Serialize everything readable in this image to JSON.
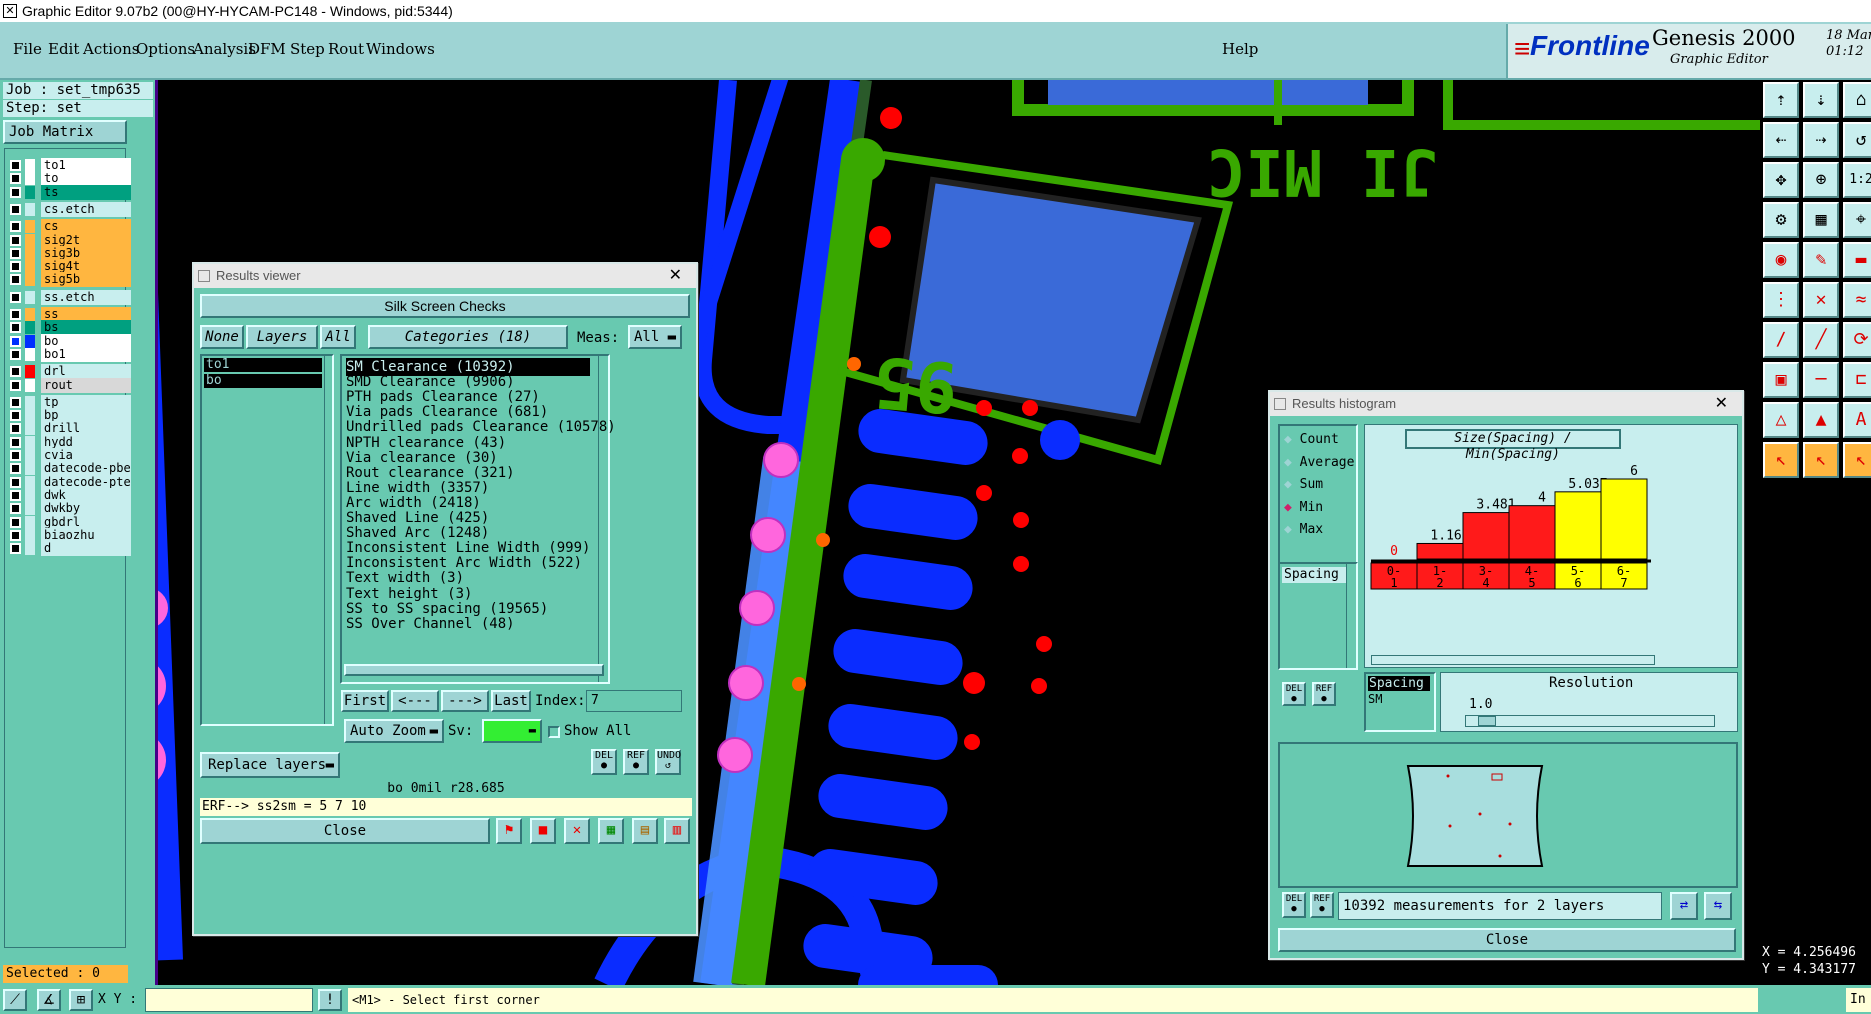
{
  "window": {
    "title": "Graphic Editor 9.07b2 (00@HY-HYCAM-PC148 - Windows, pid:5344)"
  },
  "menu": {
    "items": [
      "File",
      "Edit",
      "Actions",
      "Options",
      "Analysis",
      "DFM",
      "Step",
      "Rout",
      "Windows"
    ],
    "help": "Help"
  },
  "brand": {
    "logo": "Frontline",
    "product": "Genesis 2000",
    "subtitle": "Graphic Editor",
    "date": "18 Mar",
    "time": "01:12"
  },
  "left": {
    "job": "Job : set_tmp635",
    "step": "Step: set",
    "job_matrix": "Job Matrix ...",
    "layers": [
      {
        "name": "to1",
        "color": "#ffffff",
        "bg": "#ffffff",
        "checked": false
      },
      {
        "name": "to",
        "color": "#ffffff",
        "bg": "#ffffff",
        "checked": false
      },
      {
        "name": "ts",
        "color": "#009f80",
        "bg": "#00a080",
        "checked": false
      },
      {
        "name": "cs.etch",
        "color": "#c8eeee",
        "bg": "#c8eeee",
        "checked": false
      },
      {
        "name": "cs",
        "color": "#ffb640",
        "bg": "#ffb640",
        "checked": false
      },
      {
        "name": "sig2t",
        "color": "#ffb640",
        "bg": "#ffb640",
        "checked": false
      },
      {
        "name": "sig3b",
        "color": "#ffb640",
        "bg": "#ffb640",
        "checked": false
      },
      {
        "name": "sig4t",
        "color": "#ffb640",
        "bg": "#ffb640",
        "checked": false
      },
      {
        "name": "sig5b",
        "color": "#ffb640",
        "bg": "#ffb640",
        "checked": false
      },
      {
        "name": "ss.etch",
        "color": "#c8eeee",
        "bg": "#c8eeee",
        "checked": false
      },
      {
        "name": "ss",
        "color": "#ffb640",
        "bg": "#ffb640",
        "checked": false
      },
      {
        "name": "bs",
        "color": "#009f80",
        "bg": "#00a080",
        "checked": false
      },
      {
        "name": "bo",
        "color": "#0030ff",
        "bg": "#ffffff",
        "checked": true
      },
      {
        "name": "bo1",
        "color": "#ffffff",
        "bg": "#ffffff",
        "checked": false
      },
      {
        "name": "drl",
        "color": "#ff0000",
        "bg": "#c8eeee",
        "checked": false
      },
      {
        "name": "rout",
        "color": "#ffffff",
        "bg": "#d8d8d8",
        "checked": false
      },
      {
        "name": "tp",
        "color": "#c8eeee",
        "bg": "#c8eeee",
        "checked": false
      },
      {
        "name": "bp",
        "color": "#c8eeee",
        "bg": "#c8eeee",
        "checked": false
      },
      {
        "name": "drill",
        "color": "#c8eeee",
        "bg": "#c8eeee",
        "checked": false
      },
      {
        "name": "hydd",
        "color": "#c8eeee",
        "bg": "#c8eeee",
        "checked": false
      },
      {
        "name": "cvia",
        "color": "#c8eeee",
        "bg": "#c8eeee",
        "checked": false
      },
      {
        "name": "datecode-pbe",
        "color": "#c8eeee",
        "bg": "#c8eeee",
        "checked": false
      },
      {
        "name": "datecode-pte",
        "color": "#c8eeee",
        "bg": "#c8eeee",
        "checked": false
      },
      {
        "name": "dwk",
        "color": "#c8eeee",
        "bg": "#c8eeee",
        "checked": false
      },
      {
        "name": "dwkby",
        "color": "#c8eeee",
        "bg": "#c8eeee",
        "checked": false
      },
      {
        "name": "gbdrl",
        "color": "#c8eeee",
        "bg": "#c8eeee",
        "checked": false
      },
      {
        "name": "biaozhu",
        "color": "#c8eeee",
        "bg": "#c8eeee",
        "checked": false
      },
      {
        "name": "d",
        "color": "#c8eeee",
        "bg": "#c8eeee",
        "checked": false
      }
    ],
    "selected": "Selected : 0"
  },
  "results_viewer": {
    "title": "Results viewer",
    "header": "Silk Screen Checks",
    "none": "None",
    "layers": "Layers",
    "all": "All",
    "categories_label": "Categories (18)",
    "meas_label": "Meas:",
    "meas_value": "All",
    "layer_list": [
      "to1",
      "bo"
    ],
    "categories": [
      "SM Clearance (10392)",
      "SMD Clearance (9906)",
      "PTH pads Clearance (27)",
      "Via pads Clearance (681)",
      "Undrilled pads Clearance (10578)",
      "NPTH clearance (43)",
      "Via clearance (30)",
      "Rout clearance (321)",
      "Line width (3357)",
      "Arc width (2418)",
      "Shaved Line (425)",
      "Shaved Arc (1248)",
      "Inconsistent Line Width (999)",
      "Inconsistent Arc Width (522)",
      "Text width (3)",
      "Text height (3)",
      "SS to SS spacing (19565)",
      "SS Over Channel (48)"
    ],
    "first": "First",
    "prev": "<---",
    "next": "--->",
    "last": "Last",
    "index_label": "Index:",
    "index_value": "7",
    "auto_zoom": "Auto Zoom",
    "sv_label": "Sv:",
    "show_all": "Show All",
    "replace_layers": "Replace layers",
    "status1": "bo 0mil  r28.685",
    "status2": "ERF--> ss2sm = 5 7 10",
    "close": "Close"
  },
  "histogram": {
    "title": "Results histogram",
    "options": [
      "Count",
      "Average",
      "Sum",
      "Min",
      "Max"
    ],
    "selected_option": "Min",
    "axis_title": "Size(Spacing) / Min(Spacing)",
    "list_item": "Spacing",
    "bars": [
      {
        "range": "0-1",
        "value": 0,
        "label": "0"
      },
      {
        "range": "1-2",
        "value": 1.165,
        "label": "1.165"
      },
      {
        "range": "3-4",
        "value": 3.481,
        "label": "3.481"
      },
      {
        "range": "4-5",
        "value": 4,
        "label": "4"
      },
      {
        "range": "5-6",
        "value": 5.037,
        "label": "5.037"
      },
      {
        "range": "6-7",
        "value": 6,
        "label": "6"
      }
    ],
    "bin_labels": [
      [
        "0-",
        "1"
      ],
      [
        "1-",
        "2"
      ],
      [
        "3-",
        "4"
      ],
      [
        "4-",
        "5"
      ],
      [
        "5-",
        "6"
      ],
      [
        "6-",
        "7"
      ]
    ],
    "list2": [
      "Spacing",
      "SM"
    ],
    "resolution_label": "Resolution",
    "resolution_value": "1.0",
    "measurements": "10392 measurements for 2 layers",
    "close": "Close"
  },
  "statusbar": {
    "xy_label": "X Y :",
    "prompt": "<M1> - Select first corner",
    "x": "X = 4.256496",
    "y": "Y = 4.343177",
    "mode": "In"
  },
  "canvas_text": {
    "silk1": "JI MIC",
    "silk2": "95"
  }
}
